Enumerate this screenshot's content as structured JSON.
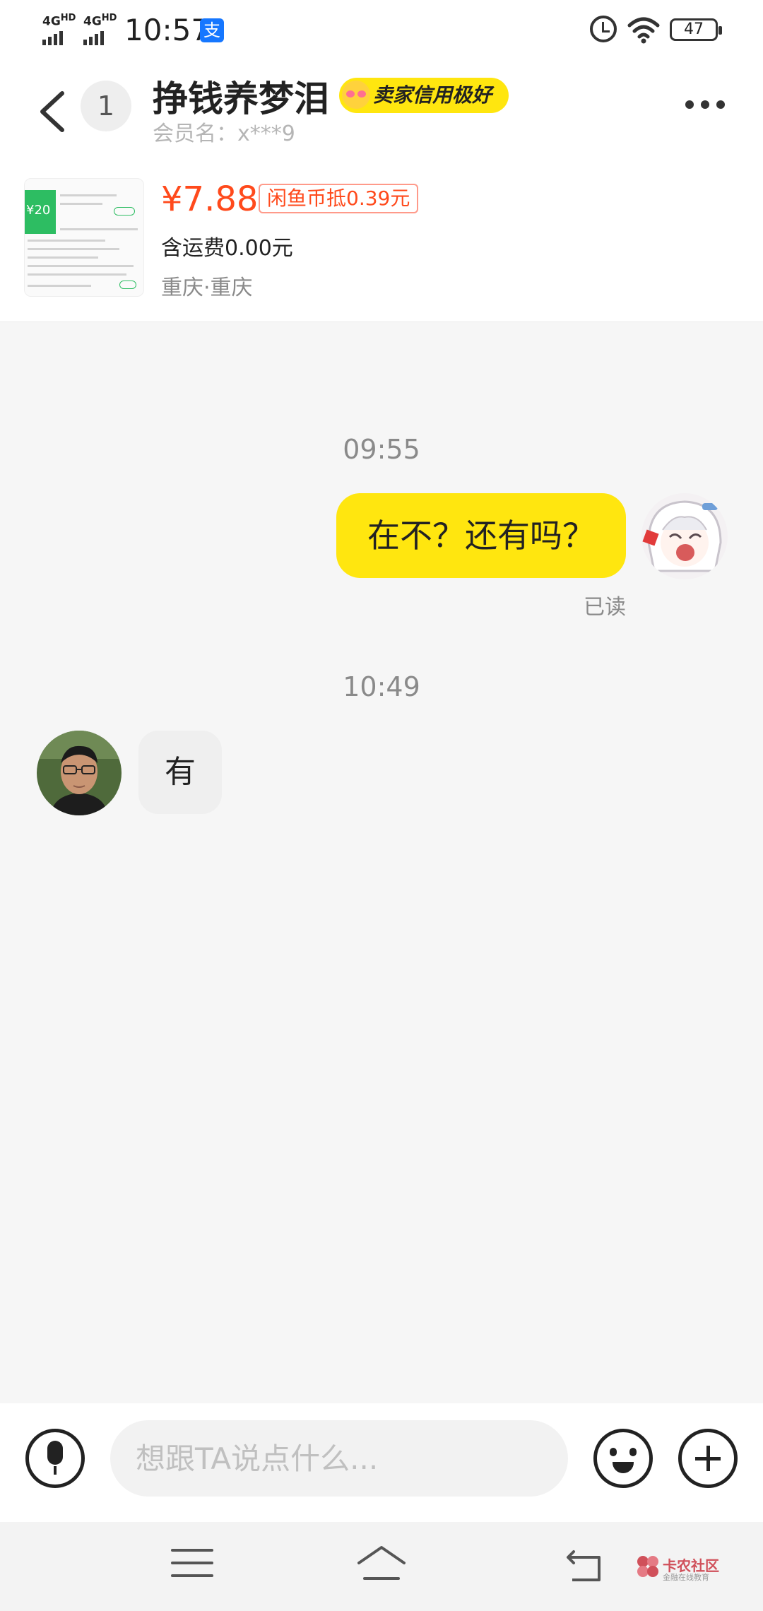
{
  "status_bar": {
    "sim1": "4G",
    "sim1_sup": "HD",
    "sim2": "4G",
    "sim2_sup": "HD",
    "time": "10:57",
    "pay_icon": "alipay-icon",
    "pay_glyph": "支",
    "alarm_icon": "alarm-icon",
    "wifi_icon": "wifi-icon",
    "battery": "47"
  },
  "header": {
    "back_icon": "chevron-left-icon",
    "unread_count": "1",
    "nickname": "挣钱养梦泪",
    "credit_badge": "卖家信用极好",
    "member_label": "会员名：x***9",
    "more_icon": "more-icon"
  },
  "product": {
    "price": "¥7.88",
    "coin_deduct": "闲鱼币抵0.39元",
    "shipping": "含运费0.00元",
    "location": "重庆·重庆",
    "thumb_value": "¥20"
  },
  "chat": {
    "messages": [
      {
        "time": "09:55",
        "from": "me",
        "text": "在不？还有吗？",
        "status": "已读"
      },
      {
        "time": "10:49",
        "from": "other",
        "text": "有"
      }
    ]
  },
  "input_bar": {
    "voice_icon": "microphone-icon",
    "placeholder": "想跟TA说点什么...",
    "emoji_icon": "emoji-icon",
    "plus_icon": "plus-icon"
  },
  "nav_bar": {
    "menu_icon": "menu-icon",
    "home_icon": "home-icon",
    "back_icon": "back-icon",
    "watermark_title": "卡农社区",
    "watermark_sub": "金融在线教育"
  },
  "colors": {
    "accent_yellow": "#ffe60f",
    "price_red": "#ff4a1c"
  }
}
